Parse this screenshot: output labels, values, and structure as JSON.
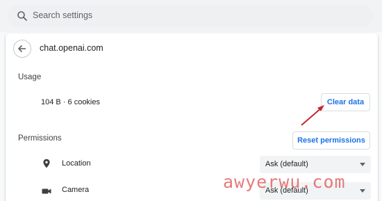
{
  "search": {
    "placeholder": "Search settings"
  },
  "site": {
    "title": "chat.openai.com"
  },
  "usage": {
    "label": "Usage",
    "summary": "104 B · 6 cookies",
    "clear_button": "Clear data"
  },
  "permissions": {
    "label": "Permissions",
    "reset_button": "Reset permissions",
    "items": [
      {
        "label": "Location",
        "value": "Ask (default)",
        "icon": "location-pin-icon"
      },
      {
        "label": "Camera",
        "value": "Ask (default)",
        "icon": "camera-icon"
      }
    ]
  },
  "watermark": "awyerwu.com",
  "colors": {
    "accent": "#1a73e8",
    "annotation_arrow": "#c0282d",
    "watermark": "#de4646"
  }
}
